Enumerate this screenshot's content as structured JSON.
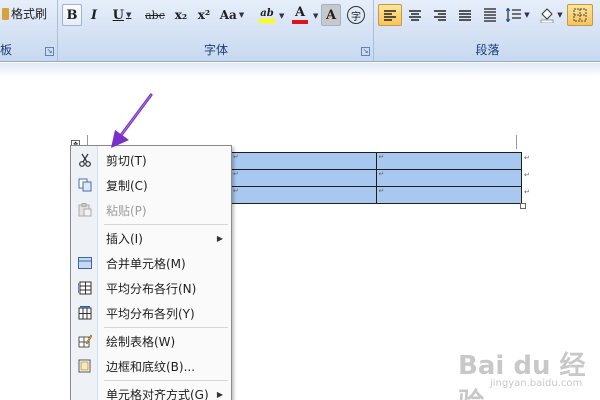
{
  "ribbon": {
    "format_painter": "格式刷",
    "clipboard_suffix": "板",
    "font_group": "字体",
    "paragraph_group": "段落",
    "font_buttons": {
      "bold": "B",
      "italic": "I",
      "underline": "U",
      "strike": "abc",
      "subscript": "x₂",
      "superscript": "x²",
      "change_case": "Aa",
      "highlight": "ab",
      "font_color": "A",
      "char_shade": "A",
      "enclose": "字"
    }
  },
  "table": {
    "rows": [
      [
        "↵",
        "↵"
      ],
      [
        "↵",
        "↵"
      ],
      [
        "↵",
        "↵"
      ]
    ],
    "end_marks": [
      "↵",
      "↵",
      "↵"
    ]
  },
  "context_menu": {
    "items": [
      {
        "label": "剪切(T)",
        "icon": "scissors-icon"
      },
      {
        "label": "复制(C)",
        "icon": "copy-icon"
      },
      {
        "label": "粘贴(P)",
        "icon": "paste-icon",
        "disabled": true
      },
      {
        "label": "插入(I)",
        "submenu": true
      },
      {
        "label": "合并单元格(M)",
        "icon": "merge-cells-icon"
      },
      {
        "label": "平均分布各行(N)",
        "icon": "distribute-rows-icon"
      },
      {
        "label": "平均分布各列(Y)",
        "icon": "distribute-columns-icon"
      },
      {
        "label": "绘制表格(W)",
        "icon": "draw-table-icon"
      },
      {
        "label": "边框和底纹(B)...",
        "icon": "borders-shading-icon"
      },
      {
        "label": "单元格对齐方式(G)",
        "submenu": true
      }
    ]
  },
  "watermark": {
    "logo": "Bai du 经验",
    "url": "jingyan.baidu.com"
  },
  "colors": {
    "ribbon_bg": "#d5e2f4",
    "table_selection": "#a8c8f0",
    "arrow": "#7a2fc8"
  }
}
